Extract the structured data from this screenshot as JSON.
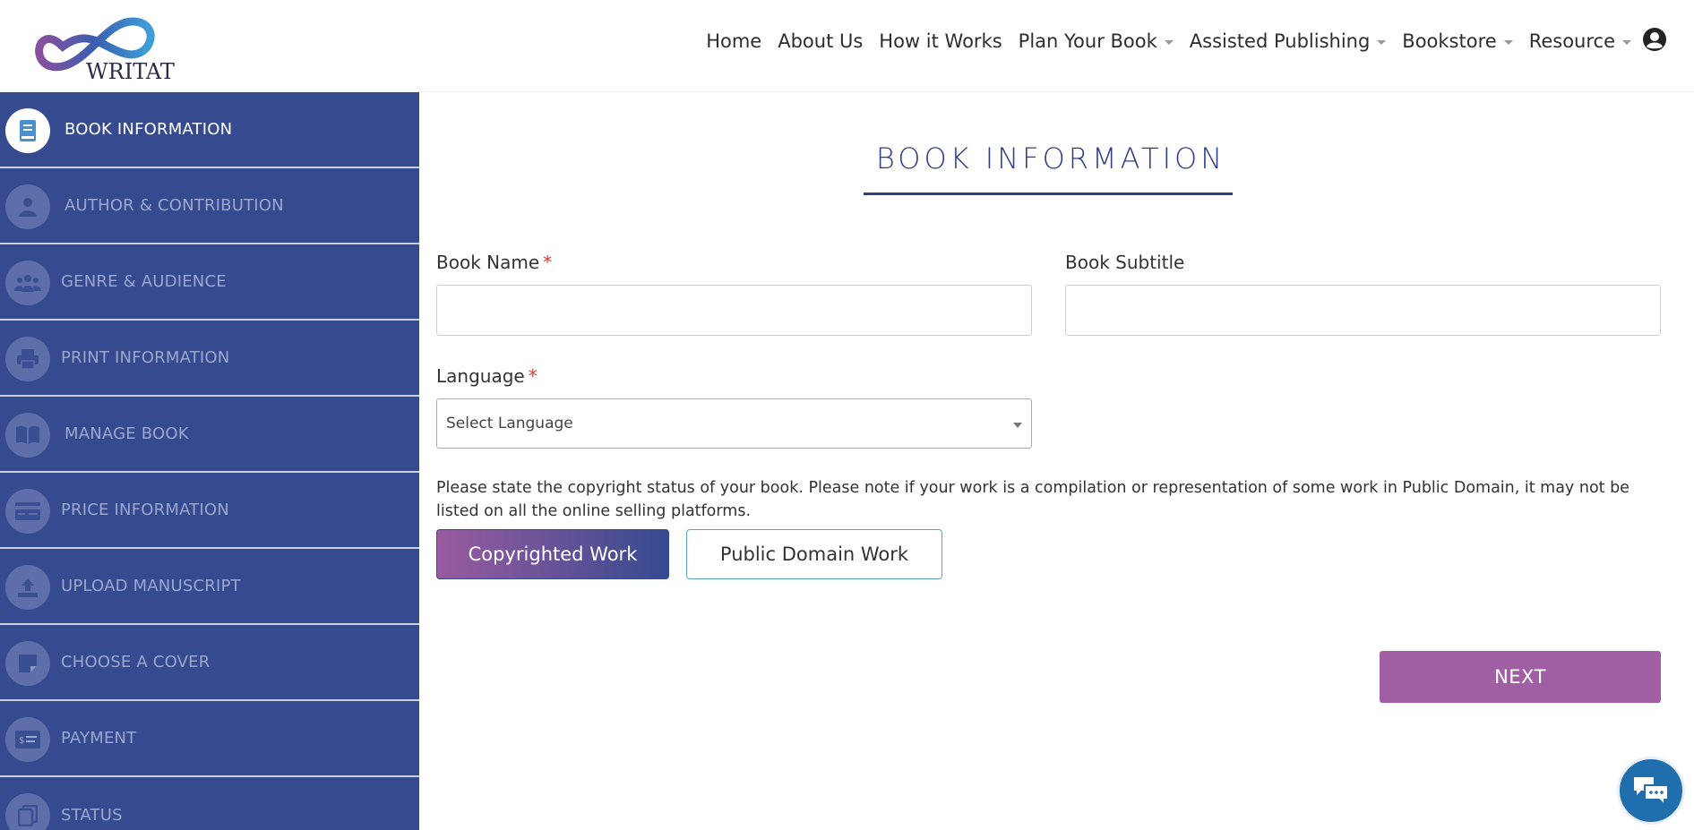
{
  "header": {
    "logo_text": "WRITAT",
    "nav": [
      {
        "label": "Home",
        "dropdown": false
      },
      {
        "label": "About Us",
        "dropdown": false
      },
      {
        "label": "How it Works",
        "dropdown": false
      },
      {
        "label": "Plan Your Book",
        "dropdown": true
      },
      {
        "label": "Assisted Publishing",
        "dropdown": true
      },
      {
        "label": "Bookstore",
        "dropdown": true
      },
      {
        "label": "Resource",
        "dropdown": true
      }
    ]
  },
  "sidebar": {
    "items": [
      {
        "label": "BOOK INFORMATION",
        "icon": "book-icon",
        "active": true
      },
      {
        "label": "AUTHOR & CONTRIBUTION",
        "icon": "person-icon",
        "active": false
      },
      {
        "label": "GENRE & AUDIENCE",
        "icon": "group-icon",
        "active": false
      },
      {
        "label": "PRINT INFORMATION",
        "icon": "printer-icon",
        "active": false
      },
      {
        "label": "MANAGE BOOK",
        "icon": "open-book-icon",
        "active": false
      },
      {
        "label": "PRICE INFORMATION",
        "icon": "card-icon",
        "active": false
      },
      {
        "label": "UPLOAD MANUSCRIPT",
        "icon": "upload-icon",
        "active": false
      },
      {
        "label": "CHOOSE A COVER",
        "icon": "sticky-note-icon",
        "active": false
      },
      {
        "label": "PAYMENT",
        "icon": "money-icon",
        "active": false
      },
      {
        "label": "STATUS",
        "icon": "copy-icon",
        "active": false
      }
    ]
  },
  "main": {
    "title": "BOOK INFORMATION",
    "book_name_label": "Book Name",
    "book_name_value": "",
    "book_subtitle_label": "Book Subtitle",
    "book_subtitle_value": "",
    "language_label": "Language",
    "language_selected": "Select Language",
    "required_mark": "*",
    "copyright_notice": "Please state the copyright status of your book. Please note if your work is a compilation or representation of some work in Public Domain, it may not be listed on all the online selling platforms.",
    "copyrighted_label": "Copyrighted Work",
    "public_domain_label": "Public Domain Work",
    "next_label": "NEXT"
  },
  "colors": {
    "sidebar_bg": "#354a8f",
    "accent_purple": "#a05fa2",
    "title_blue": "#2f3e86",
    "chat_blue": "#1f6fae"
  }
}
